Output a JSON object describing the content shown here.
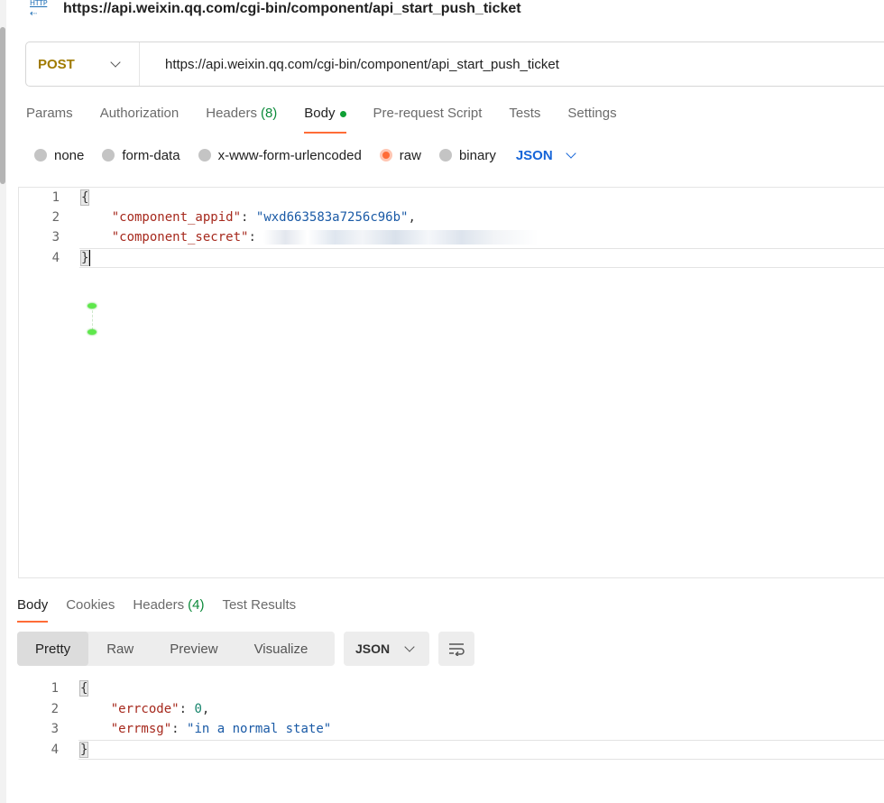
{
  "request": {
    "title": "https://api.weixin.qq.com/cgi-bin/component/api_start_push_ticket",
    "icon_text": "HTTP",
    "method": "POST",
    "url": "https://api.weixin.qq.com/cgi-bin/component/api_start_push_ticket"
  },
  "request_tabs": [
    {
      "label": "Params"
    },
    {
      "label": "Authorization"
    },
    {
      "label": "Headers",
      "count": "(8)"
    },
    {
      "label": "Body",
      "active": true
    },
    {
      "label": "Pre-request Script"
    },
    {
      "label": "Tests"
    },
    {
      "label": "Settings"
    }
  ],
  "body_types": [
    "none",
    "form-data",
    "x-www-form-urlencoded",
    "raw",
    "binary"
  ],
  "body_type_selected": "raw",
  "body_format": "JSON",
  "request_body": {
    "line_numbers": [
      "1",
      "2",
      "3",
      "4"
    ],
    "open_brace": "{",
    "close_brace": "}",
    "key1": "\"component_appid\"",
    "val1": "\"wxd663583a7256c96b\"",
    "key2": "\"component_secret\"",
    "colon": ":",
    "comma": ","
  },
  "response_tabs": [
    {
      "label": "Body",
      "active": true
    },
    {
      "label": "Cookies"
    },
    {
      "label": "Headers",
      "count": "(4)"
    },
    {
      "label": "Test Results"
    }
  ],
  "response_view_modes": [
    "Pretty",
    "Raw",
    "Preview",
    "Visualize"
  ],
  "response_view_selected": "Pretty",
  "response_format": "JSON",
  "response_body": {
    "line_numbers": [
      "1",
      "2",
      "3",
      "4"
    ],
    "open_brace": "{",
    "close_brace": "}",
    "key1": "\"errcode\"",
    "val1": "0",
    "key2": "\"errmsg\"",
    "val2": "\"in a normal state\"",
    "colon": ":",
    "comma": ","
  },
  "colors": {
    "accent": "#ff6c37",
    "method": "#a07b00",
    "json_link": "#1665d8",
    "count_green": "#0c8a3a"
  }
}
